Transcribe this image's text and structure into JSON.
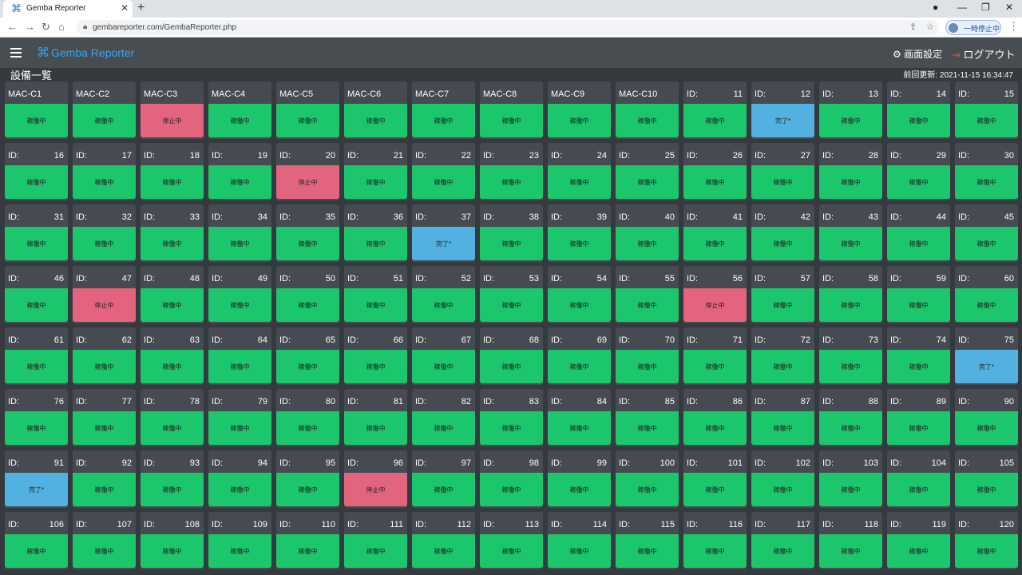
{
  "browser": {
    "tab_title": "Gemba Reporter",
    "url": "gembareporter.com/GembaReporter.php",
    "profile_label": "一時停止中"
  },
  "header": {
    "brand": "Gemba Reporter",
    "settings_label": "画面設定",
    "logout_label": "ログアウト"
  },
  "page": {
    "title": "設備一覧",
    "last_updated": "前回更新: 2021-11-15 16:34:47"
  },
  "status_labels": {
    "running": "稼働中",
    "stopped": "停止中",
    "done": "完了*"
  },
  "colors": {
    "running": "#1bc66d",
    "stopped": "#e3647f",
    "done": "#52b1e0",
    "brand": "#3aa2f0"
  },
  "machines": [
    {
      "name": "MAC-C1",
      "status": "running"
    },
    {
      "name": "MAC-C2",
      "status": "running"
    },
    {
      "name": "MAC-C3",
      "status": "stopped"
    },
    {
      "name": "MAC-C4",
      "status": "running"
    },
    {
      "name": "MAC-C5",
      "status": "running"
    },
    {
      "name": "MAC-C6",
      "status": "running"
    },
    {
      "name": "MAC-C7",
      "status": "running"
    },
    {
      "name": "MAC-C8",
      "status": "running"
    },
    {
      "name": "MAC-C9",
      "status": "running"
    },
    {
      "name": "MAC-C10",
      "status": "running"
    },
    {
      "id": 11,
      "status": "running"
    },
    {
      "id": 12,
      "status": "done"
    },
    {
      "id": 13,
      "status": "running"
    },
    {
      "id": 14,
      "status": "running"
    },
    {
      "id": 15,
      "status": "running"
    },
    {
      "id": 16,
      "status": "running"
    },
    {
      "id": 17,
      "status": "running"
    },
    {
      "id": 18,
      "status": "running"
    },
    {
      "id": 19,
      "status": "running"
    },
    {
      "id": 20,
      "status": "stopped"
    },
    {
      "id": 21,
      "status": "running"
    },
    {
      "id": 22,
      "status": "running"
    },
    {
      "id": 23,
      "status": "running"
    },
    {
      "id": 24,
      "status": "running"
    },
    {
      "id": 25,
      "status": "running"
    },
    {
      "id": 26,
      "status": "running"
    },
    {
      "id": 27,
      "status": "running"
    },
    {
      "id": 28,
      "status": "running"
    },
    {
      "id": 29,
      "status": "running"
    },
    {
      "id": 30,
      "status": "running"
    },
    {
      "id": 31,
      "status": "running"
    },
    {
      "id": 32,
      "status": "running"
    },
    {
      "id": 33,
      "status": "running"
    },
    {
      "id": 34,
      "status": "running"
    },
    {
      "id": 35,
      "status": "running"
    },
    {
      "id": 36,
      "status": "running"
    },
    {
      "id": 37,
      "status": "done"
    },
    {
      "id": 38,
      "status": "running"
    },
    {
      "id": 39,
      "status": "running"
    },
    {
      "id": 40,
      "status": "running"
    },
    {
      "id": 41,
      "status": "running"
    },
    {
      "id": 42,
      "status": "running"
    },
    {
      "id": 43,
      "status": "running"
    },
    {
      "id": 44,
      "status": "running"
    },
    {
      "id": 45,
      "status": "running"
    },
    {
      "id": 46,
      "status": "running"
    },
    {
      "id": 47,
      "status": "stopped"
    },
    {
      "id": 48,
      "status": "running"
    },
    {
      "id": 49,
      "status": "running"
    },
    {
      "id": 50,
      "status": "running"
    },
    {
      "id": 51,
      "status": "running"
    },
    {
      "id": 52,
      "status": "running"
    },
    {
      "id": 53,
      "status": "running"
    },
    {
      "id": 54,
      "status": "running"
    },
    {
      "id": 55,
      "status": "running"
    },
    {
      "id": 56,
      "status": "stopped"
    },
    {
      "id": 57,
      "status": "running"
    },
    {
      "id": 58,
      "status": "running"
    },
    {
      "id": 59,
      "status": "running"
    },
    {
      "id": 60,
      "status": "running"
    },
    {
      "id": 61,
      "status": "running"
    },
    {
      "id": 62,
      "status": "running"
    },
    {
      "id": 63,
      "status": "running"
    },
    {
      "id": 64,
      "status": "running"
    },
    {
      "id": 65,
      "status": "running"
    },
    {
      "id": 66,
      "status": "running"
    },
    {
      "id": 67,
      "status": "running"
    },
    {
      "id": 68,
      "status": "running"
    },
    {
      "id": 69,
      "status": "running"
    },
    {
      "id": 70,
      "status": "running"
    },
    {
      "id": 71,
      "status": "running"
    },
    {
      "id": 72,
      "status": "running"
    },
    {
      "id": 73,
      "status": "running"
    },
    {
      "id": 74,
      "status": "running"
    },
    {
      "id": 75,
      "status": "done"
    },
    {
      "id": 76,
      "status": "running"
    },
    {
      "id": 77,
      "status": "running"
    },
    {
      "id": 78,
      "status": "running"
    },
    {
      "id": 79,
      "status": "running"
    },
    {
      "id": 80,
      "status": "running"
    },
    {
      "id": 81,
      "status": "running"
    },
    {
      "id": 82,
      "status": "running"
    },
    {
      "id": 83,
      "status": "running"
    },
    {
      "id": 84,
      "status": "running"
    },
    {
      "id": 85,
      "status": "running"
    },
    {
      "id": 86,
      "status": "running"
    },
    {
      "id": 87,
      "status": "running"
    },
    {
      "id": 88,
      "status": "running"
    },
    {
      "id": 89,
      "status": "running"
    },
    {
      "id": 90,
      "status": "running"
    },
    {
      "id": 91,
      "status": "done"
    },
    {
      "id": 92,
      "status": "running"
    },
    {
      "id": 93,
      "status": "running"
    },
    {
      "id": 94,
      "status": "running"
    },
    {
      "id": 95,
      "status": "running"
    },
    {
      "id": 96,
      "status": "stopped"
    },
    {
      "id": 97,
      "status": "running"
    },
    {
      "id": 98,
      "status": "running"
    },
    {
      "id": 99,
      "status": "running"
    },
    {
      "id": 100,
      "status": "running"
    },
    {
      "id": 101,
      "status": "running"
    },
    {
      "id": 102,
      "status": "running"
    },
    {
      "id": 103,
      "status": "running"
    },
    {
      "id": 104,
      "status": "running"
    },
    {
      "id": 105,
      "status": "running"
    },
    {
      "id": 106,
      "status": "running"
    },
    {
      "id": 107,
      "status": "running"
    },
    {
      "id": 108,
      "status": "running"
    },
    {
      "id": 109,
      "status": "running"
    },
    {
      "id": 110,
      "status": "running"
    },
    {
      "id": 111,
      "status": "running"
    },
    {
      "id": 112,
      "status": "running"
    },
    {
      "id": 113,
      "status": "running"
    },
    {
      "id": 114,
      "status": "running"
    },
    {
      "id": 115,
      "status": "running"
    },
    {
      "id": 116,
      "status": "running"
    },
    {
      "id": 117,
      "status": "running"
    },
    {
      "id": 118,
      "status": "running"
    },
    {
      "id": 119,
      "status": "running"
    },
    {
      "id": 120,
      "status": "running"
    }
  ]
}
